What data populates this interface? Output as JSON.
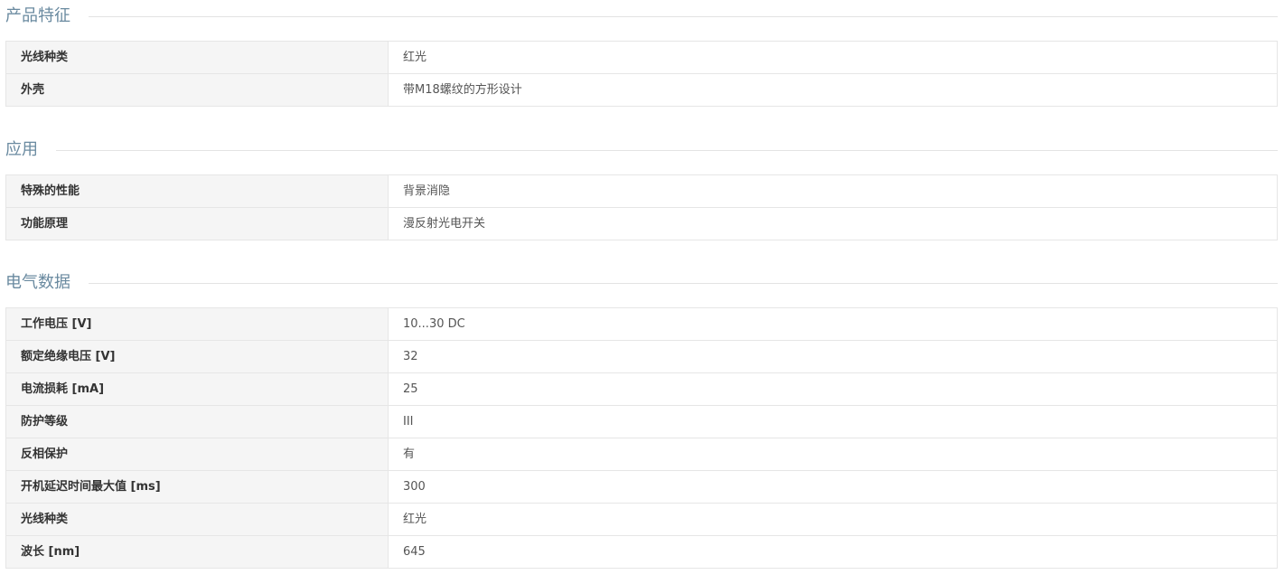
{
  "sections": [
    {
      "title": "产品特征",
      "rows": [
        {
          "label": "光线种类",
          "value": "红光"
        },
        {
          "label": "外壳",
          "value": "带M18螺纹的方形设计"
        }
      ]
    },
    {
      "title": "应用",
      "rows": [
        {
          "label": "特殊的性能",
          "value": "背景消隐"
        },
        {
          "label": "功能原理",
          "value": "漫反射光电开关"
        }
      ]
    },
    {
      "title": "电气数据",
      "rows": [
        {
          "label": "工作电压 [V]",
          "value": "10...30 DC"
        },
        {
          "label": "额定绝缘电压 [V]",
          "value": "32"
        },
        {
          "label": "电流损耗 [mA]",
          "value": "25"
        },
        {
          "label": "防护等级",
          "value": "III"
        },
        {
          "label": "反相保护",
          "value": "有"
        },
        {
          "label": "开机延迟时间最大值 [ms]",
          "value": "300"
        },
        {
          "label": "光线种类",
          "value": "红光"
        },
        {
          "label": "波长 [nm]",
          "value": "645"
        }
      ]
    }
  ]
}
